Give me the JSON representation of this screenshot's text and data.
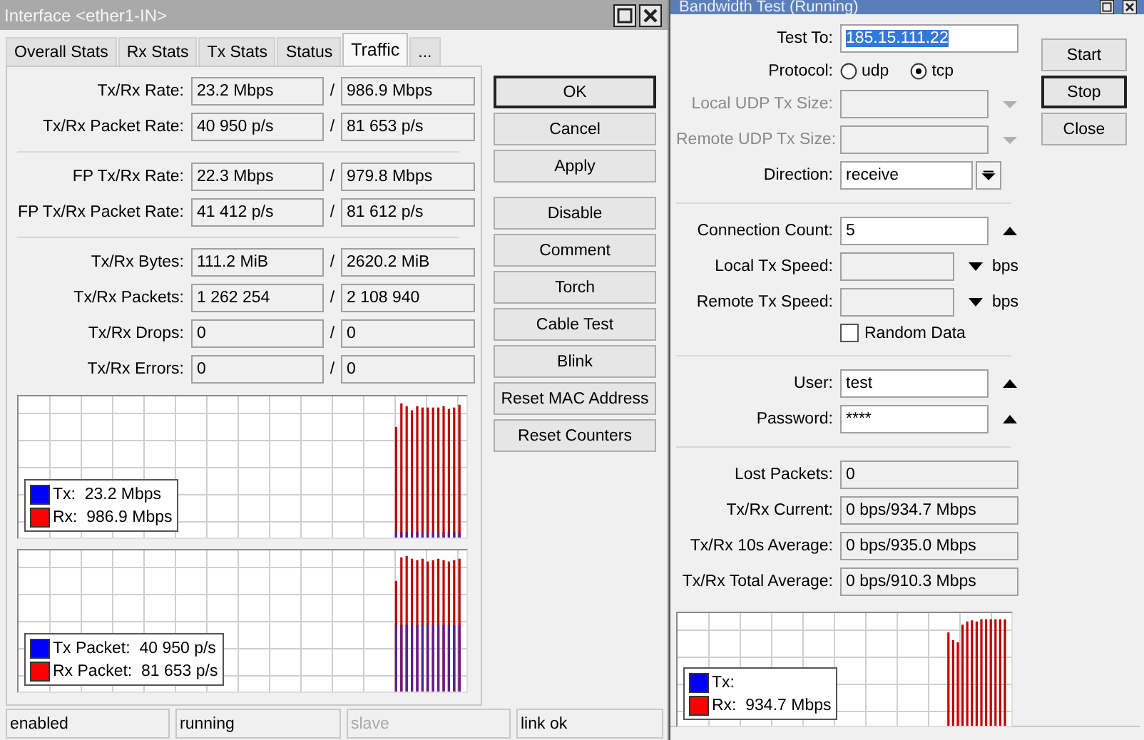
{
  "interface_window": {
    "title": "Interface <ether1-IN>",
    "tabs": [
      {
        "label": "Overall Stats",
        "selected": false
      },
      {
        "label": "Rx Stats",
        "selected": false
      },
      {
        "label": "Tx Stats",
        "selected": false
      },
      {
        "label": "Status",
        "selected": false
      },
      {
        "label": "Traffic",
        "selected": true
      },
      {
        "label": "...",
        "selected": false
      }
    ],
    "sections": [
      [
        {
          "label": "Tx/Rx Rate:",
          "tx": "23.2 Mbps",
          "rx": "986.9 Mbps"
        },
        {
          "label": "Tx/Rx Packet Rate:",
          "tx": "40 950 p/s",
          "rx": "81 653 p/s"
        }
      ],
      [
        {
          "label": "FP Tx/Rx Rate:",
          "tx": "22.3 Mbps",
          "rx": "979.8 Mbps"
        },
        {
          "label": "FP Tx/Rx Packet Rate:",
          "tx": "41 412 p/s",
          "rx": "81 612 p/s"
        }
      ],
      [
        {
          "label": "Tx/Rx Bytes:",
          "tx": "111.2 MiB",
          "rx": "2620.2 MiB"
        },
        {
          "label": "Tx/Rx Packets:",
          "tx": "1 262 254",
          "rx": "2 108 940"
        },
        {
          "label": "Tx/Rx Drops:",
          "tx": "0",
          "rx": "0"
        },
        {
          "label": "Tx/Rx Errors:",
          "tx": "0",
          "rx": "0"
        }
      ]
    ],
    "separator": "/",
    "graphs": [
      {
        "legend": [
          {
            "text": "Tx:  23.2 Mbps",
            "color": "#0000ff"
          },
          {
            "text": "Rx:  986.9 Mbps",
            "color": "#ff0000"
          }
        ]
      },
      {
        "legend": [
          {
            "text": "Tx Packet:  40 950 p/s",
            "color": "#0000ff"
          },
          {
            "text": "Rx Packet:  81 653 p/s",
            "color": "#ff0000"
          }
        ]
      }
    ],
    "button_groups": [
      [
        {
          "label": "OK",
          "default": true
        },
        {
          "label": "Cancel",
          "default": false
        },
        {
          "label": "Apply",
          "default": false
        }
      ],
      [
        {
          "label": "Disable",
          "default": false
        },
        {
          "label": "Comment",
          "default": false
        },
        {
          "label": "Torch",
          "default": false
        },
        {
          "label": "Cable Test",
          "default": false
        },
        {
          "label": "Blink",
          "default": false
        },
        {
          "label": "Reset MAC Address",
          "default": false
        },
        {
          "label": "Reset Counters",
          "default": false
        }
      ]
    ],
    "status_bar": [
      {
        "text": "enabled",
        "disabled": false
      },
      {
        "text": "running",
        "disabled": false
      },
      {
        "text": "slave",
        "disabled": true
      },
      {
        "text": "link ok",
        "disabled": false
      }
    ]
  },
  "bandwidth_test": {
    "title": "Bandwidth Test (Running)",
    "rows": [
      {
        "kind": "field",
        "label": "Test To:",
        "value": "185.15.111.22",
        "text_selected": true,
        "disabled": false,
        "readonly": false
      },
      {
        "kind": "radio",
        "label": "Protocol:",
        "options": [
          {
            "label": "udp",
            "selected": false
          },
          {
            "label": "tcp",
            "selected": true
          }
        ]
      },
      {
        "kind": "dropdown",
        "label": "Local UDP Tx Size:",
        "disabled": true,
        "readonly": true
      },
      {
        "kind": "dropdown",
        "label": "Remote UDP Tx Size:",
        "disabled": true,
        "readonly": true
      },
      {
        "kind": "combo",
        "label": "Direction:",
        "value": "receive",
        "disabled": false,
        "readonly": false
      },
      {
        "kind": "divider"
      },
      {
        "kind": "spin",
        "label": "Connection Count:",
        "value": "5",
        "disabled": false,
        "readonly": false
      },
      {
        "kind": "speed",
        "label": "Local Tx Speed:",
        "disabled": false,
        "readonly": true,
        "unit": "bps"
      },
      {
        "kind": "speed",
        "label": "Remote Tx Speed:",
        "disabled": false,
        "readonly": true,
        "unit": "bps"
      },
      {
        "kind": "checkbox",
        "label": "Random Data",
        "checked": false
      },
      {
        "kind": "divider"
      },
      {
        "kind": "spin",
        "label": "User:",
        "value": "test",
        "disabled": false,
        "readonly": false
      },
      {
        "kind": "spin",
        "label": "Password:",
        "value": "****",
        "disabled": false,
        "readonly": false
      },
      {
        "kind": "divider"
      },
      {
        "kind": "field",
        "label": "Lost Packets:",
        "value": "0",
        "disabled": false,
        "readonly": true
      },
      {
        "kind": "field",
        "label": "Tx/Rx Current:",
        "value": "0 bps/934.7 Mbps",
        "disabled": false,
        "readonly": true
      },
      {
        "kind": "field",
        "label": "Tx/Rx 10s Average:",
        "value": "0 bps/935.0 Mbps",
        "disabled": false,
        "readonly": true
      },
      {
        "kind": "field",
        "label": "Tx/Rx Total Average:",
        "value": "0 bps/910.3 Mbps",
        "disabled": false,
        "readonly": true
      }
    ],
    "graph": {
      "legend": [
        {
          "text": "Tx:",
          "color": "#0000ff"
        },
        {
          "text": "Rx:  934.7 Mbps",
          "color": "#ff0000"
        }
      ]
    },
    "buttons": [
      {
        "label": "Start",
        "default": false
      },
      {
        "label": "Stop",
        "default": true
      },
      {
        "label": "Close",
        "default": false
      }
    ]
  }
}
